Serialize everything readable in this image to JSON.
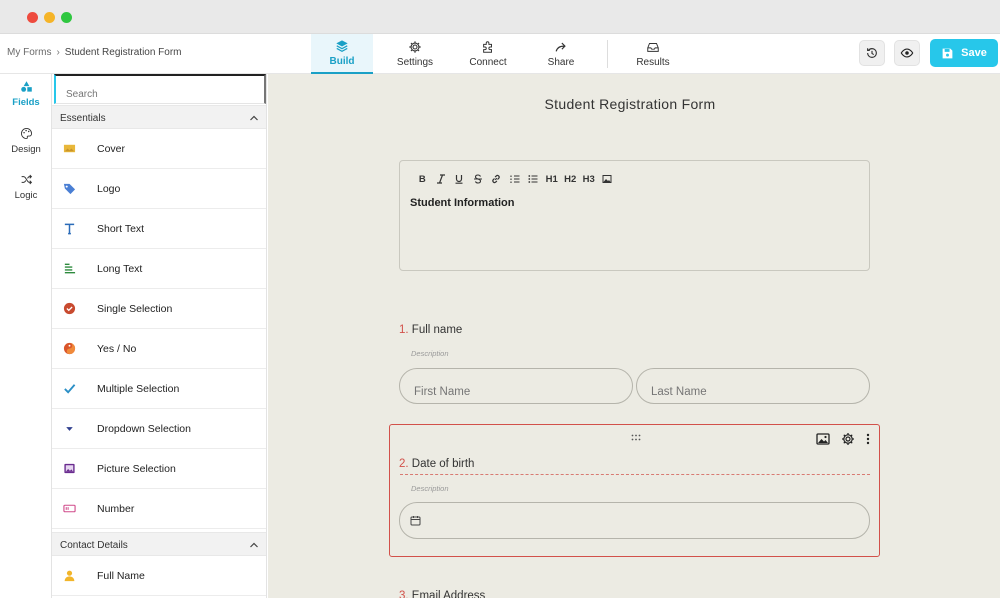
{
  "breadcrumb": {
    "parent": "My Forms",
    "separator": "›",
    "current": "Student Registration Form"
  },
  "nav": [
    {
      "label": "Build",
      "icon": "layers-icon",
      "active": true
    },
    {
      "label": "Settings",
      "icon": "gear-icon",
      "active": false
    },
    {
      "label": "Connect",
      "icon": "puzzle-icon",
      "active": false
    },
    {
      "label": "Share",
      "icon": "share-icon",
      "active": false
    },
    {
      "label": "Results",
      "icon": "inbox-icon",
      "active": false
    }
  ],
  "toolbar": {
    "history_icon": "history-icon",
    "preview_icon": "eye-icon",
    "save_label": "Save",
    "save_icon": "save-icon"
  },
  "rail": [
    {
      "label": "Fields",
      "icon": "shapes-icon",
      "active": true
    },
    {
      "label": "Design",
      "icon": "palette-icon",
      "active": false
    },
    {
      "label": "Logic",
      "icon": "shuffle-icon",
      "active": false
    }
  ],
  "panel": {
    "search_placeholder": "Search",
    "sections": [
      {
        "title": "Essentials",
        "items": [
          {
            "label": "Cover",
            "icon": "cover-icon"
          },
          {
            "label": "Logo",
            "icon": "tag-icon"
          },
          {
            "label": "Short Text",
            "icon": "text-icon"
          },
          {
            "label": "Long Text",
            "icon": "long-text-icon"
          },
          {
            "label": "Single Selection",
            "icon": "radio-check-icon"
          },
          {
            "label": "Yes / No",
            "icon": "yes-no-icon"
          },
          {
            "label": "Multiple Selection",
            "icon": "checkmark-icon"
          },
          {
            "label": "Dropdown Selection",
            "icon": "caret-down-icon"
          },
          {
            "label": "Picture Selection",
            "icon": "picture-icon"
          },
          {
            "label": "Number",
            "icon": "number-icon"
          }
        ]
      },
      {
        "title": "Contact Details",
        "items": [
          {
            "label": "Full Name",
            "icon": "person-icon"
          }
        ]
      }
    ]
  },
  "form": {
    "title": "Student Registration Form",
    "rte": {
      "tools": [
        "B",
        "I",
        "U",
        "S",
        "link",
        "ol",
        "ul",
        "H1",
        "H2",
        "H3",
        "image"
      ],
      "content": "Student Information"
    },
    "questions": [
      {
        "number": "1.",
        "label": "Full name",
        "description": "Description",
        "placeholders": [
          "First Name",
          "Last Name"
        ]
      },
      {
        "number": "2.",
        "label": "Date of birth",
        "description": "Description"
      },
      {
        "number": "3.",
        "label": "Email Address"
      }
    ]
  },
  "colors": {
    "accent": "#27c7ea",
    "accent_text": "#1aa0c6",
    "error": "#d2514a",
    "canvas": "#ecebe3"
  }
}
